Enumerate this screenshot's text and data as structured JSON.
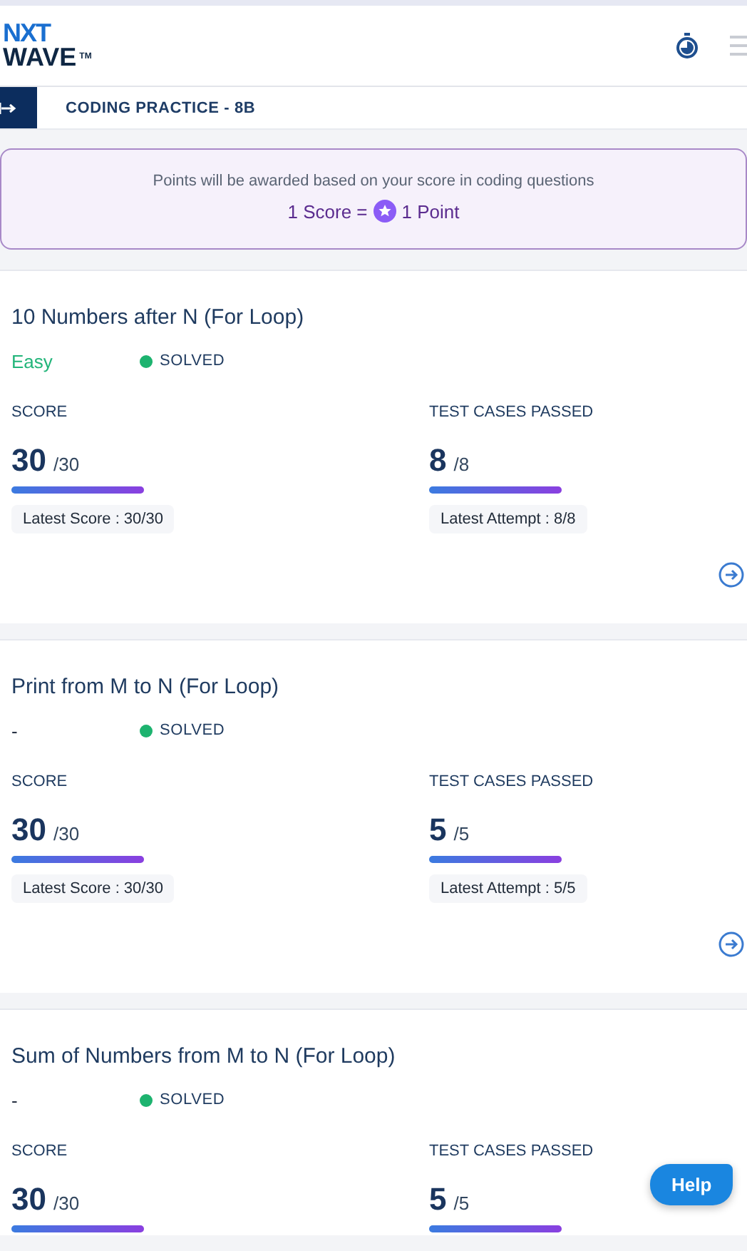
{
  "logo": {
    "line_1": "NXT",
    "line_2": "WAVE",
    "mark": "TM"
  },
  "breadcrumb": {
    "title": "CODING PRACTICE - 8B"
  },
  "points_banner": {
    "text": "Points will be awarded based on your score in coding questions",
    "score_label": "1 Score =",
    "point_label": "1 Point"
  },
  "questions": [
    {
      "title": "10 Numbers after N (For Loop)",
      "difficulty": {
        "label": "Easy",
        "color": "#22b57a"
      },
      "status": {
        "label": "SOLVED",
        "color": "#1db36f"
      },
      "score": {
        "label": "SCORE",
        "value": "30",
        "total": "/30",
        "level": 1,
        "latest": "Latest Score : 30/30"
      },
      "tests": {
        "label": "TEST CASES PASSED",
        "value": "8",
        "total": "/8",
        "level": 1,
        "latest": "Latest Attempt : 8/8"
      }
    },
    {
      "title": "Print from M to N (For Loop)",
      "difficulty": {
        "label": "-",
        "color": "#1e293b"
      },
      "status": {
        "label": "SOLVED",
        "color": "#1db36f"
      },
      "score": {
        "label": "SCORE",
        "value": "30",
        "total": "/30",
        "level": 1,
        "latest": "Latest Score : 30/30"
      },
      "tests": {
        "label": "TEST CASES PASSED",
        "value": "5",
        "total": "/5",
        "level": 1,
        "latest": "Latest Attempt : 5/5"
      }
    },
    {
      "title": "Sum of Numbers from M to N (For Loop)",
      "difficulty": {
        "label": "-",
        "color": "#1e293b"
      },
      "status": {
        "label": "SOLVED",
        "color": "#1db36f"
      },
      "score": {
        "label": "SCORE",
        "value": "30",
        "total": "/30",
        "level": 1
      },
      "tests": {
        "label": "TEST CASES PASSED",
        "value": "5",
        "total": "/5",
        "level": 1
      }
    }
  ],
  "help_button": {
    "label": "Help"
  }
}
